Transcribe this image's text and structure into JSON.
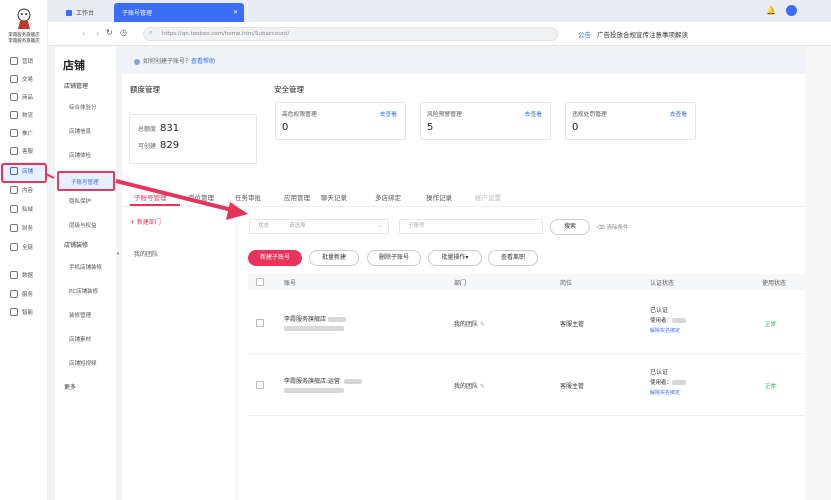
{
  "leftbar": {
    "shop_line1": "李霞服务旗舰店",
    "shop_line2": "李霞服务旗舰店",
    "items": [
      {
        "label": "营销",
        "icon": "megaphone-icon"
      },
      {
        "label": "交易",
        "icon": "receipt-icon"
      },
      {
        "label": "商品",
        "icon": "box-icon"
      },
      {
        "label": "物流",
        "icon": "truck-icon"
      },
      {
        "label": "推广",
        "icon": "location-icon"
      },
      {
        "label": "客服",
        "icon": "headset-icon"
      },
      {
        "label": "店铺",
        "icon": "store-icon"
      },
      {
        "label": "内容",
        "icon": "content-icon"
      },
      {
        "label": "私域",
        "icon": "users-icon"
      },
      {
        "label": "财务",
        "icon": "money-icon"
      },
      {
        "label": "全链",
        "icon": "chain-icon"
      },
      {
        "label": "数据",
        "icon": "chart-icon"
      },
      {
        "label": "服务",
        "icon": "grid-icon"
      },
      {
        "label": "智能",
        "icon": "bulb-icon"
      }
    ]
  },
  "tabs": {
    "workbench": "工作台",
    "subaccount": "子账号管理"
  },
  "addressbar": {
    "url": "https://qn.taobao.com/home.htm/Subaccount/",
    "notice_label": "公告",
    "notice_text": "广告投放合规宣传注意事项解读"
  },
  "sidebar": {
    "title": "店铺",
    "groups": [
      {
        "label": "店铺管理",
        "items": [
          "综合体验分",
          "店铺信息",
          "店铺体检",
          "子账号管理",
          "隐私保护",
          "层级与权益"
        ]
      },
      {
        "label": "店铺装修",
        "items": [
          "手机店铺装修",
          "PC店铺装修",
          "装修管理",
          "店铺素材",
          "店铺短视频"
        ]
      }
    ],
    "more": "更多"
  },
  "help": {
    "text": "如何创建子账号？",
    "link": "查看帮助"
  },
  "quota": {
    "title": "额度管理",
    "total_label": "总额度",
    "total": "831",
    "created_label": "可创建",
    "created": "829"
  },
  "security": {
    "title": "安全管理",
    "cards": [
      {
        "title": "高危权限管理",
        "value": "0",
        "link": "去查看"
      },
      {
        "title": "风险预警管理",
        "value": "5",
        "link": "去查看"
      },
      {
        "title": "违规处罚管理",
        "value": "0",
        "link": "去查看"
      }
    ]
  },
  "nav_tabs": [
    "子账号管理",
    "岗位管理",
    "任务审批",
    "应用管理",
    "聊天记录",
    "多店绑定",
    "操作记录",
    "帐户设置"
  ],
  "left_panel": {
    "add_dept": "+ 新建部门",
    "team": "我的团队"
  },
  "filters": {
    "status": "状态",
    "status_placeholder": "请选择",
    "account_placeholder": "子账号",
    "search": "搜索",
    "clear": "清除条件"
  },
  "actions": [
    "新建子账号",
    "批量新建",
    "删除子账号",
    "批量操作",
    "查看离职"
  ],
  "table": {
    "headers": [
      "账号",
      "部门",
      "岗位",
      "认证状态",
      "使用状态"
    ],
    "rows": [
      {
        "account": "李霞服务旗舰店",
        "dept": "我的团队",
        "role": "客服主管",
        "auth": "已认证",
        "user_label": "使用者：",
        "unbind": "解除实名绑定",
        "status": "正常"
      },
      {
        "account": "李霞服务旗舰店:运营.",
        "dept": "我的团队",
        "role": "客服主管",
        "auth": "已认证",
        "user_label": "使用者：",
        "unbind": "解除实名绑定",
        "status": "正常"
      }
    ]
  },
  "colors": {
    "primary": "#3b6ef6",
    "accent": "#e8335a",
    "success": "#2fb36b"
  }
}
